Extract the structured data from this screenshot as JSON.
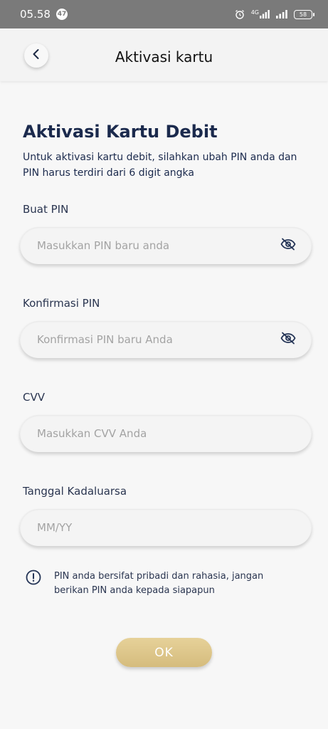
{
  "status_bar": {
    "time": "05.58",
    "notification_count": "47",
    "network_label": "4G",
    "battery_level": "58"
  },
  "header": {
    "title": "Aktivasi kartu"
  },
  "main": {
    "title": "Aktivasi Kartu Debit",
    "intro": "Untuk aktivasi kartu debit, silahkan ubah PIN anda dan PIN harus terdiri dari 6 digit angka",
    "fields": [
      {
        "label": "Buat PIN",
        "placeholder": "Masukkan PIN baru anda",
        "value": ""
      },
      {
        "label": "Konfirmasi PIN",
        "placeholder": "Konfirmasi PIN baru Anda",
        "value": ""
      },
      {
        "label": "CVV",
        "placeholder": "Masukkan CVV Anda",
        "value": ""
      },
      {
        "label": "Tanggal Kadaluarsa",
        "placeholder": "MM/YY",
        "value": ""
      }
    ],
    "notice": "PIN anda bersifat pribadi dan rahasia, jangan berikan PIN anda kepada siapapun",
    "ok_label": "OK"
  },
  "colors": {
    "primary_text": "#1b2a4d",
    "accent_gold": "#dcc58a",
    "background": "#f7f7f7"
  },
  "icons": {
    "back": "chevron-left-icon",
    "visibility": "eye-off-icon",
    "info": "info-circle-icon",
    "alarm": "alarm-icon",
    "signal": "signal-icon"
  }
}
